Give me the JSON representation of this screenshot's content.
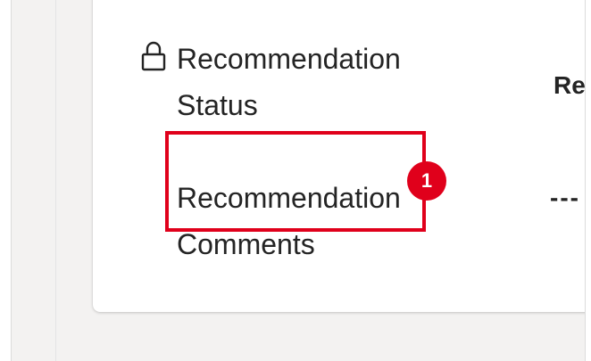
{
  "fields": {
    "status": {
      "label_line1": "Recommendation",
      "label_line2": "Status",
      "value": "Re",
      "lock_icon": "lock-icon"
    },
    "comments": {
      "label_line1": "Recommendation",
      "label_line2": "Comments",
      "value": "---"
    }
  },
  "annotation": {
    "badge_number": "1",
    "color": "#e0001b"
  }
}
